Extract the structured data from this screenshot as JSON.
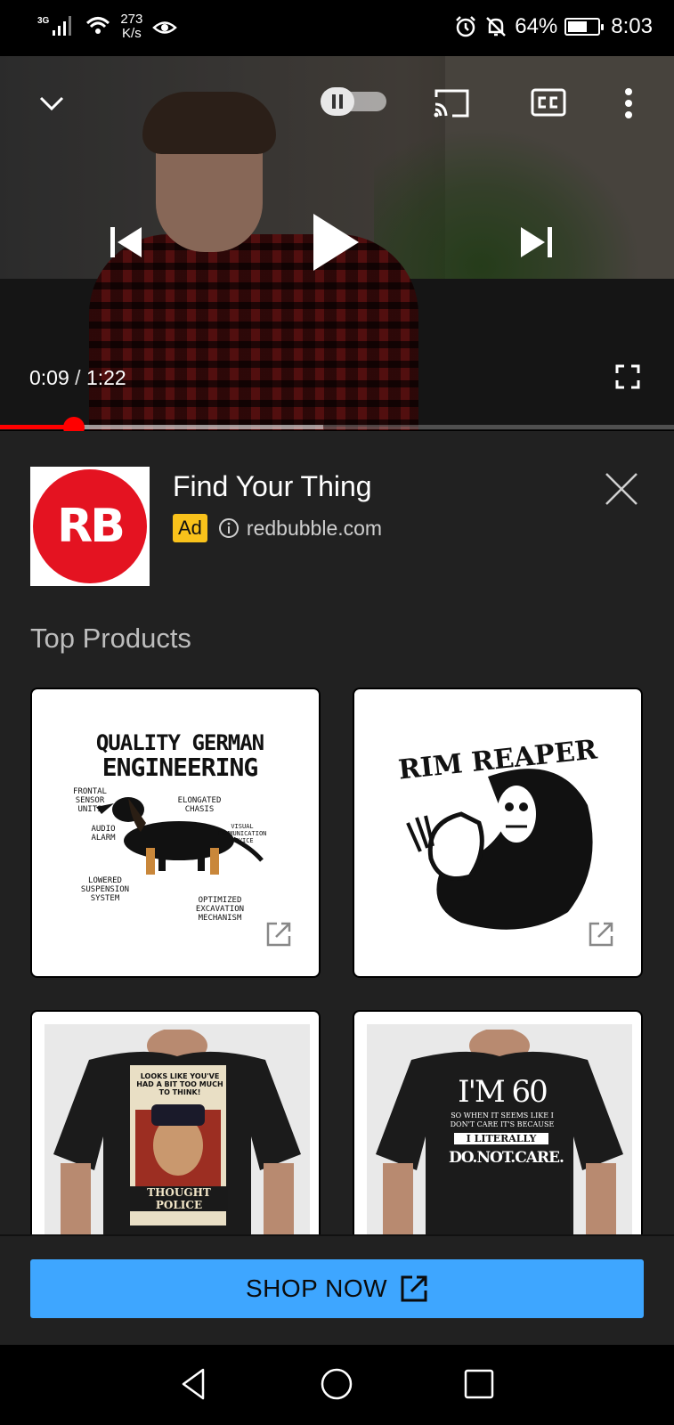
{
  "status_bar": {
    "network_type": "3G",
    "speed_value": "273",
    "speed_unit": "K/s",
    "battery_percent": "64%",
    "battery_level": 0.64,
    "time": "8:03"
  },
  "player": {
    "current_time": "0:09",
    "separator": "/",
    "duration": "1:22",
    "played_fraction": 0.11,
    "buffered_fraction": 0.48,
    "autoplay_on": false,
    "controls": {
      "collapse_icon": "chevron-down-icon",
      "autoplay_icon": "pause-icon",
      "cast_icon": "cast-icon",
      "captions_icon": "closed-captions-icon",
      "more_icon": "more-vertical-icon",
      "previous_icon": "skip-previous-icon",
      "play_icon": "play-icon",
      "next_icon": "skip-next-icon",
      "fullscreen_icon": "fullscreen-icon"
    },
    "accent_color": "#ff0000"
  },
  "ad": {
    "logo_text": "RB",
    "logo_color": "#e41321",
    "title": "Find Your Thing",
    "badge": "Ad",
    "badge_color": "#f9c21b",
    "domain": "redbubble.com",
    "section_title": "Top Products",
    "products": [
      {
        "type": "sticker",
        "headline_1": "QUALITY GERMAN",
        "headline_2": "ENGINEERING",
        "labels": [
          "FRONTAL SENSOR UNITS",
          "ELONGATED CHASIS",
          "AUDIO ALARM",
          "VISUAL COMMUNICATION DEVICE",
          "LOWERED SUSPENSION SYSTEM",
          "OPTIMIZED EXCAVATION MECHANISM"
        ]
      },
      {
        "type": "sticker",
        "headline_1": "RIM REAPER"
      },
      {
        "type": "t-shirt",
        "print_top": "LOOKS LIKE YOU'VE HAD A BIT TOO MUCH TO THINK!",
        "print_bottom": "THOUGHT POLICE"
      },
      {
        "type": "t-shirt",
        "print_top": "I'M 60",
        "print_mid": "SO WHEN IT SEEMS LIKE I DON'T CARE IT'S BECAUSE",
        "print_highlight": "I LITERALLY",
        "print_bottom": "DO.NOT.CARE."
      }
    ],
    "cta_label": "SHOP NOW",
    "cta_color": "#3ea6ff"
  },
  "nav_bar": {
    "back_icon": "back-triangle-icon",
    "home_icon": "home-circle-icon",
    "recents_icon": "recents-square-icon"
  }
}
